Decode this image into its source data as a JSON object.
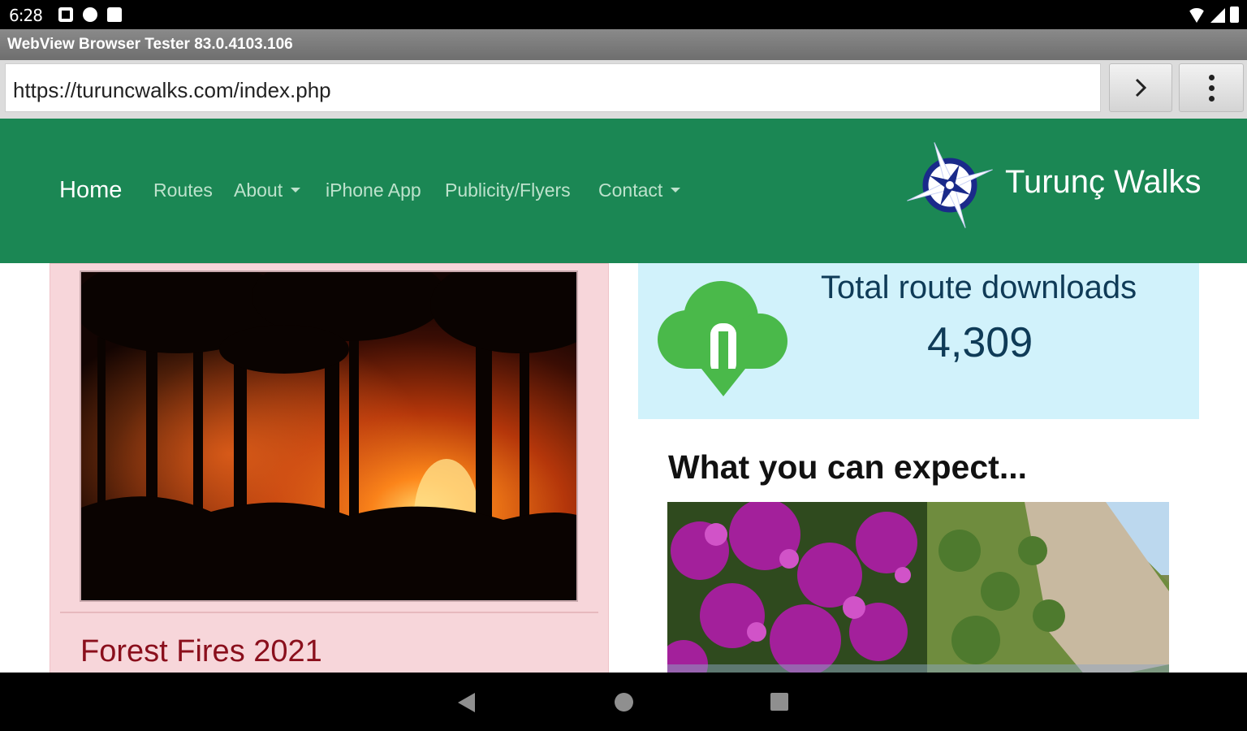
{
  "status_bar": {
    "time": "6:28",
    "left_icons": [
      "square-notification-icon",
      "round-notification-icon",
      "bag-notification-icon"
    ],
    "right_icons": [
      "wifi-icon",
      "signal-icon",
      "battery-icon"
    ]
  },
  "app": {
    "title": "WebView Browser Tester 83.0.4103.106"
  },
  "url_bar": {
    "url": "https://turuncwalks.com/index.php",
    "go_icon": "chevron-right-icon",
    "menu_icon": "overflow-menu-icon"
  },
  "site": {
    "brand": "Turunç Walks",
    "nav": {
      "home": "Home",
      "routes": "Routes",
      "about": "About",
      "iphone": "iPhone App",
      "publicity": "Publicity/Flyers",
      "contact": "Contact"
    },
    "colors": {
      "navbar": "#1b8754",
      "news_card": "#f7d6da",
      "news_title": "#8a0f1c",
      "downloads_bg": "#d1f2fb",
      "downloads_text": "#0f3b57",
      "cloud": "#4ab94a"
    },
    "news": {
      "title": "Forest Fires 2021"
    },
    "downloads": {
      "label": "Total route downloads",
      "count": "4,309"
    },
    "expect": {
      "title": "What you can expect..."
    }
  },
  "system_nav": {
    "icons": [
      "back-icon",
      "home-icon",
      "recents-icon"
    ]
  }
}
